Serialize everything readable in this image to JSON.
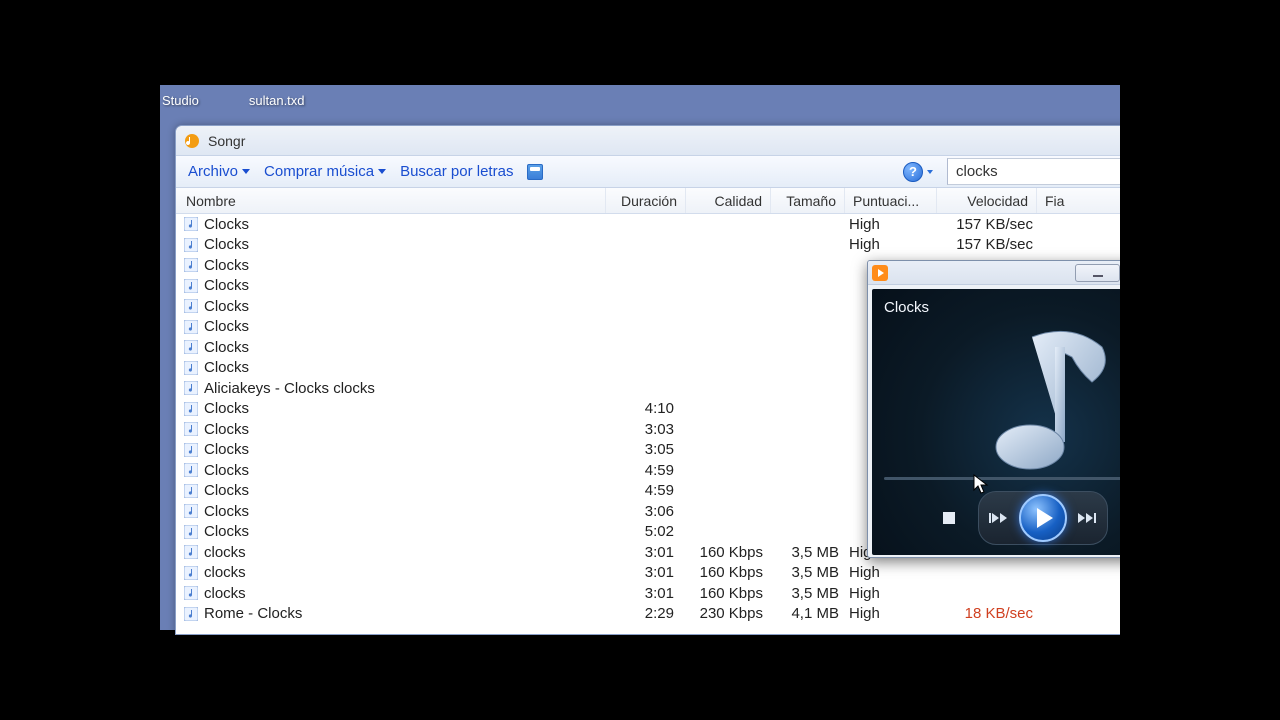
{
  "desktop": {
    "items": [
      "Studio",
      "sultan.txd"
    ]
  },
  "app": {
    "title": "Songr",
    "menu": {
      "file": "Archivo",
      "buy": "Comprar música",
      "lyrics": "Buscar por letras"
    },
    "search": "clocks",
    "columns": {
      "name": "Nombre",
      "duration": "Duración",
      "quality": "Calidad",
      "size": "Tamaño",
      "rating": "Puntuaci...",
      "speed": "Velocidad",
      "source": "Fia"
    },
    "rows": [
      {
        "name": "Clocks",
        "dur": "",
        "qual": "",
        "size": "",
        "rate": "High",
        "speed": "157 KB/sec",
        "slow": false
      },
      {
        "name": "Clocks",
        "dur": "",
        "qual": "",
        "size": "",
        "rate": "High",
        "speed": "157 KB/sec",
        "slow": false
      },
      {
        "name": "Clocks",
        "dur": "",
        "qual": "",
        "size": "",
        "rate": "",
        "speed": "",
        "slow": false
      },
      {
        "name": "Clocks",
        "dur": "",
        "qual": "",
        "size": "",
        "rate": "",
        "speed": "",
        "slow": false
      },
      {
        "name": "Clocks",
        "dur": "",
        "qual": "",
        "size": "",
        "rate": "",
        "speed": "",
        "slow": false
      },
      {
        "name": "Clocks",
        "dur": "",
        "qual": "",
        "size": "",
        "rate": "",
        "speed": "",
        "slow": false
      },
      {
        "name": "Clocks",
        "dur": "",
        "qual": "",
        "size": "",
        "rate": "",
        "speed": "",
        "slow": false
      },
      {
        "name": "Clocks",
        "dur": "",
        "qual": "",
        "size": "",
        "rate": "",
        "speed": "",
        "slow": false
      },
      {
        "name": "Aliciakeys - Clocks  clocks",
        "dur": "",
        "qual": "",
        "size": "",
        "rate": "",
        "speed": "",
        "slow": false
      },
      {
        "name": "Clocks",
        "dur": "4:10",
        "qual": "",
        "size": "",
        "rate": "",
        "speed": "",
        "slow": false
      },
      {
        "name": "Clocks",
        "dur": "3:03",
        "qual": "",
        "size": "",
        "rate": "",
        "speed": "",
        "slow": false
      },
      {
        "name": "Clocks",
        "dur": "3:05",
        "qual": "",
        "size": "",
        "rate": "",
        "speed": "",
        "slow": false
      },
      {
        "name": "Clocks",
        "dur": "4:59",
        "qual": "",
        "size": "",
        "rate": "",
        "speed": "",
        "slow": false
      },
      {
        "name": "Clocks",
        "dur": "4:59",
        "qual": "",
        "size": "",
        "rate": "",
        "speed": "",
        "slow": false
      },
      {
        "name": "Clocks",
        "dur": "3:06",
        "qual": "",
        "size": "",
        "rate": "",
        "speed": "",
        "slow": false
      },
      {
        "name": "Clocks",
        "dur": "5:02",
        "qual": "",
        "size": "",
        "rate": "",
        "speed": "",
        "slow": false
      },
      {
        "name": "clocks",
        "dur": "3:01",
        "qual": "160 Kbps",
        "size": "3,5 MB",
        "rate": "High",
        "speed": "",
        "slow": false
      },
      {
        "name": "clocks",
        "dur": "3:01",
        "qual": "160 Kbps",
        "size": "3,5 MB",
        "rate": "High",
        "speed": "",
        "slow": false
      },
      {
        "name": "clocks",
        "dur": "3:01",
        "qual": "160 Kbps",
        "size": "3,5 MB",
        "rate": "High",
        "speed": "",
        "slow": false
      },
      {
        "name": "Rome - Clocks",
        "dur": "2:29",
        "qual": "230 Kbps",
        "size": "4,1 MB",
        "rate": "High",
        "speed": "18 KB/sec",
        "slow": true
      }
    ]
  },
  "player": {
    "track": "Clocks"
  }
}
